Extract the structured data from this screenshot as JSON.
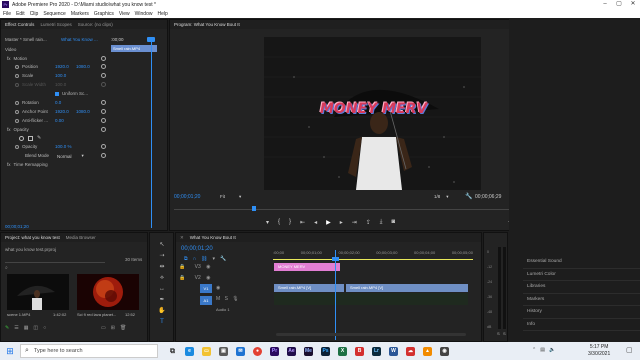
{
  "window": {
    "title": "Adobe Premiere Pro 2020 - D:\\Miami studio\\what you know test *",
    "app_abbr": "Pr"
  },
  "menu": [
    "File",
    "Edit",
    "Clip",
    "Sequence",
    "Markers",
    "Graphics",
    "View",
    "Window",
    "Help"
  ],
  "effect_controls": {
    "tabs": [
      "Effect Controls",
      "Lumetri Scopes",
      "Source: (no clips)"
    ],
    "master_label": "Master * Smell rain...",
    "sequence_label": "What You Know ...",
    "clip_chip": "Smell rain.MP4",
    "ruler_time": ":00;00",
    "video_header": "Video",
    "motion": "Motion",
    "position_label": "Position",
    "position_x": "1920.0",
    "position_y": "1080.0",
    "scale_label": "Scale",
    "scale_value": "100.0",
    "scale_width_label": "Scale Width",
    "scale_width_value": "100.0",
    "uniform_scale": "Uniform Sc...",
    "rotation_label": "Rotation",
    "rotation_value": "0.0",
    "anchor_label": "Anchor Point",
    "anchor_x": "1920.0",
    "anchor_y": "1080.0",
    "antiflicker_label": "Anti-flicker ...",
    "antiflicker_value": "0.00",
    "opacity_header": "Opacity",
    "opacity_label": "Opacity",
    "opacity_value": "100.0 %",
    "blend_label": "Blend Mode",
    "blend_value": "Normal",
    "time_remap": "Time Remapping",
    "current_time": "00;00;01;20"
  },
  "program_monitor": {
    "title": "Program: What You Know Bout It",
    "overlay_text": "MONEY MERV",
    "timecode": "00;00;01;20",
    "fit": "Fit",
    "resolution": "1/8",
    "duration": "00;00;06;29"
  },
  "project": {
    "tabs": [
      "Project: what you know test",
      "Media Browser"
    ],
    "file_name": "what you know test.prproj",
    "item_count": "30 Items",
    "items": [
      {
        "name": "scene 1.MP4",
        "duration": "1:42:02"
      },
      {
        "name": "Sci fi red lava planet...",
        "duration": "12:52"
      }
    ]
  },
  "timeline": {
    "title": "What You Know Bout It",
    "timecode": "00;00;01;20",
    "ruler": [
      ":00;00",
      "00;00;01;00",
      "00;00;02;00",
      "00;00;03;00",
      "00;00;04;00",
      "00;00;05;00"
    ],
    "graphic_clip": "MONEY MERV",
    "clip_v1_a": "Smell rain.MP4 [V]",
    "clip_v1_b": "Smell rain.MP4 [V]",
    "track_v3": "V3",
    "track_v2": "V2",
    "track_v1": "V1",
    "track_a1": "A1",
    "audio_label": "Audio 1",
    "meter_scale": [
      "0",
      "-12",
      "-24",
      "-36",
      "-48",
      "dB"
    ],
    "meter_bottom": [
      "S",
      "S"
    ]
  },
  "right_panel": [
    "Essential Sound",
    "Lumetri Color",
    "Libraries",
    "Markers",
    "History",
    "Info"
  ],
  "taskbar": {
    "search_placeholder": "Type here to search",
    "time": "5:17 PM",
    "date": "3/30/2021",
    "apps": [
      "task-view",
      "edge",
      "explorer",
      "store",
      "mail",
      "chrome",
      "premiere",
      "after-effects",
      "media-encoder",
      "photoshop",
      "excel",
      "b",
      "lightroom",
      "word",
      "cc",
      "vlc",
      "camera"
    ]
  },
  "colors": {
    "accent": "#2f8ff5",
    "graphic_clip": "#e27ed3",
    "video_clip": "#6f8fc4",
    "overlay_text": "#d83a5a"
  }
}
